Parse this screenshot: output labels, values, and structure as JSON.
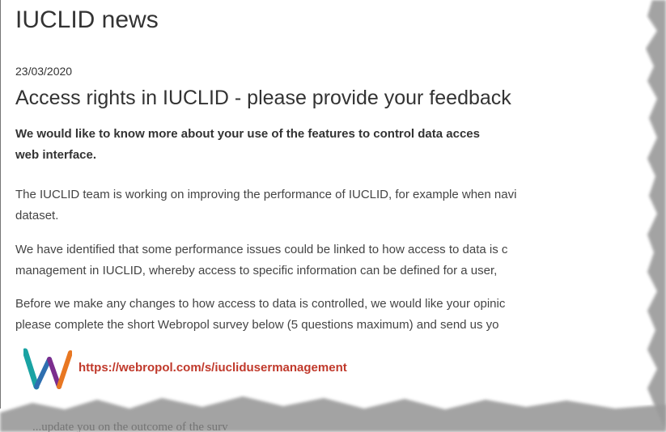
{
  "page": {
    "title": "IUCLID news",
    "date": "23/03/2020",
    "article_title": "Access rights in IUCLID - please provide your feedback",
    "lead_lines": [
      "We would like to know more about your use of the features to control data acces",
      "web interface."
    ],
    "paragraphs": [
      [
        "The IUCLID team is working on improving the performance of IUCLID, for example when navi",
        "dataset."
      ],
      [
        "We have identified that some performance issues could be linked to how access to data is c",
        "management in IUCLID, whereby access to specific information can be defined for a user,"
      ],
      [
        "Before we make any changes to how access to data is controlled, we would like your opinic",
        "please complete the short Webropol survey below (5 questions maximum) and send us yo"
      ]
    ],
    "survey_link": "https://webropol.com/s/iuclidusermanagement",
    "bottom_partial": "...update you on the outcome of the surv"
  },
  "colors": {
    "text": "#333333",
    "link": "#c0392b",
    "logo_teal": "#1aa3a3",
    "logo_purple": "#7b2d8e",
    "logo_orange": "#e87722"
  }
}
